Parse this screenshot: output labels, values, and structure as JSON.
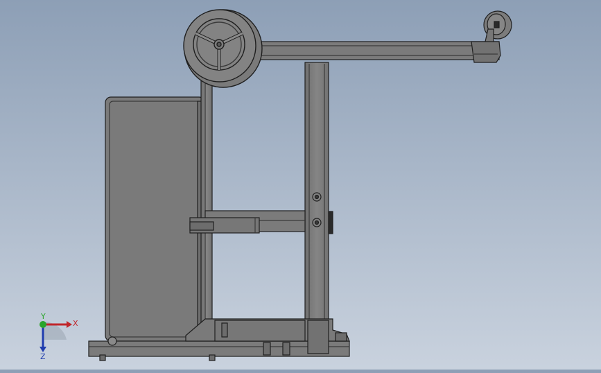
{
  "viewport": {
    "background_top": "#8d9fb6",
    "background_bottom": "#c9d2de",
    "part_fill": "#7b7b7b",
    "part_edge": "#1f1f1f",
    "part_highlight": "#8f8f8f"
  },
  "triad": {
    "x_label": "X",
    "y_label": "Y",
    "z_label": "Z",
    "x_color": "#c0262b",
    "y_color": "#2aa52a",
    "z_color": "#1f3cae"
  }
}
